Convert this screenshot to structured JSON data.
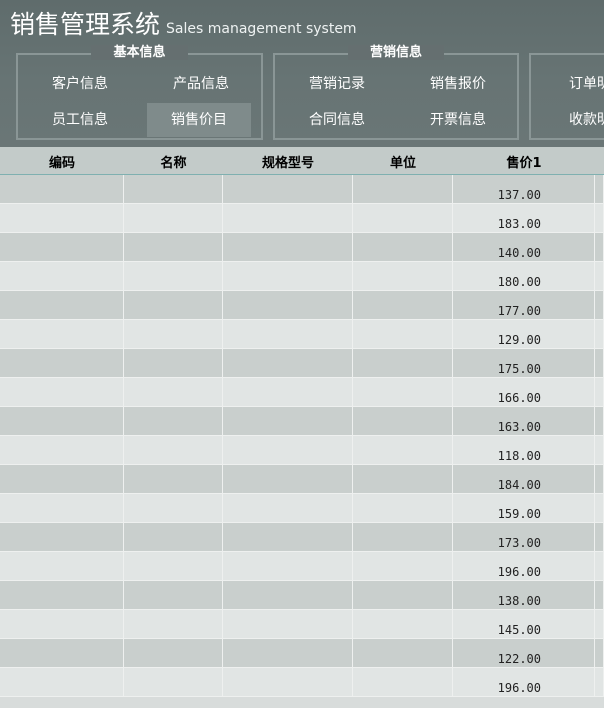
{
  "app": {
    "title_cn": "销售管理系统",
    "title_en": "Sales management system"
  },
  "groups": [
    {
      "title": "基本信息",
      "buttons": [
        "客户信息",
        "产品信息",
        "员工信息",
        "销售价目"
      ],
      "active": "销售价目"
    },
    {
      "title": "营销信息",
      "buttons": [
        "营销记录",
        "销售报价",
        "合同信息",
        "开票信息"
      ]
    },
    {
      "title": "",
      "buttons": [
        "订单明",
        "收款明"
      ]
    }
  ],
  "table": {
    "headers": [
      "编码",
      "名称",
      "规格型号",
      "单位",
      "售价1"
    ],
    "rows": [
      {
        "price": "137.00"
      },
      {
        "price": "183.00"
      },
      {
        "price": "140.00"
      },
      {
        "price": "180.00"
      },
      {
        "price": "177.00"
      },
      {
        "price": "129.00"
      },
      {
        "price": "175.00"
      },
      {
        "price": "166.00"
      },
      {
        "price": "163.00"
      },
      {
        "price": "118.00"
      },
      {
        "price": "184.00"
      },
      {
        "price": "159.00"
      },
      {
        "price": "173.00"
      },
      {
        "price": "196.00"
      },
      {
        "price": "138.00"
      },
      {
        "price": "145.00"
      },
      {
        "price": "122.00"
      },
      {
        "price": "196.00"
      }
    ]
  }
}
